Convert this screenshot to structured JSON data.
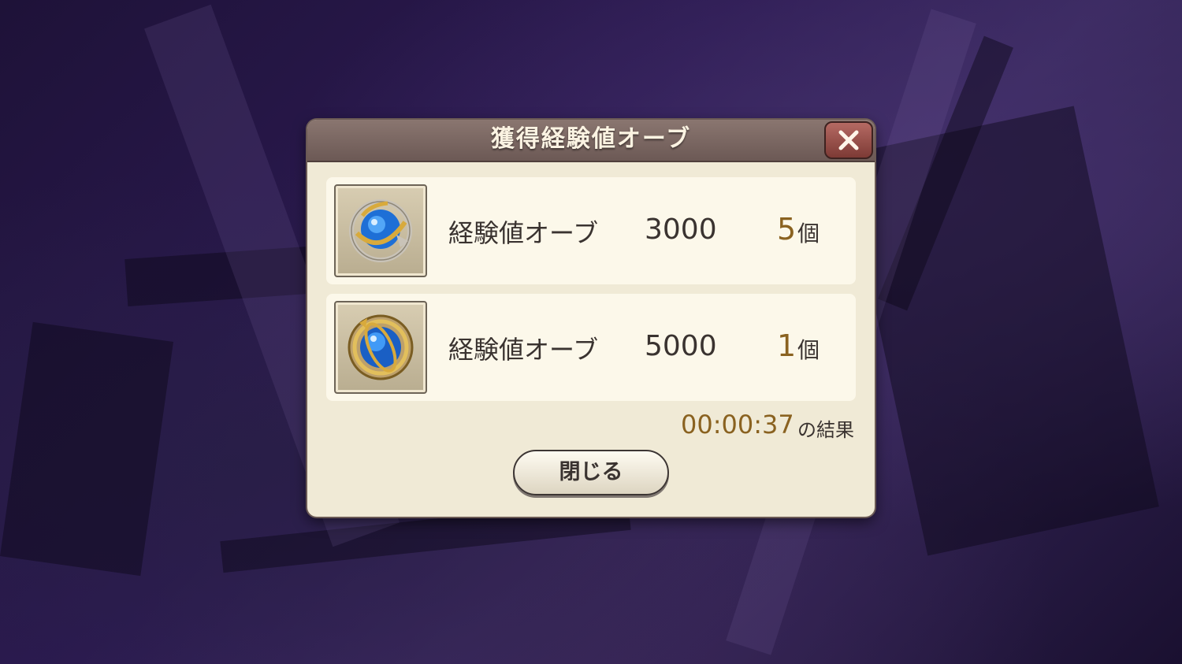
{
  "dialog": {
    "title": "獲得経験値オーブ",
    "close_button_icon": "close-x-icon",
    "items": [
      {
        "icon": "experience-orb-small-icon",
        "name": "経験値オーブ",
        "value": "3000",
        "count": "5",
        "unit": "個"
      },
      {
        "icon": "experience-orb-large-icon",
        "name": "経験値オーブ",
        "value": "5000",
        "count": "1",
        "unit": "個"
      }
    ],
    "elapsed_time": "00:00:37",
    "elapsed_suffix": "の結果",
    "close_label": "閉じる"
  },
  "colors": {
    "header": "#7a6762",
    "panel": "#f0ead6",
    "row": "#fcf8ea",
    "count_accent": "#8a6220",
    "close_button": "#9a4f49"
  }
}
